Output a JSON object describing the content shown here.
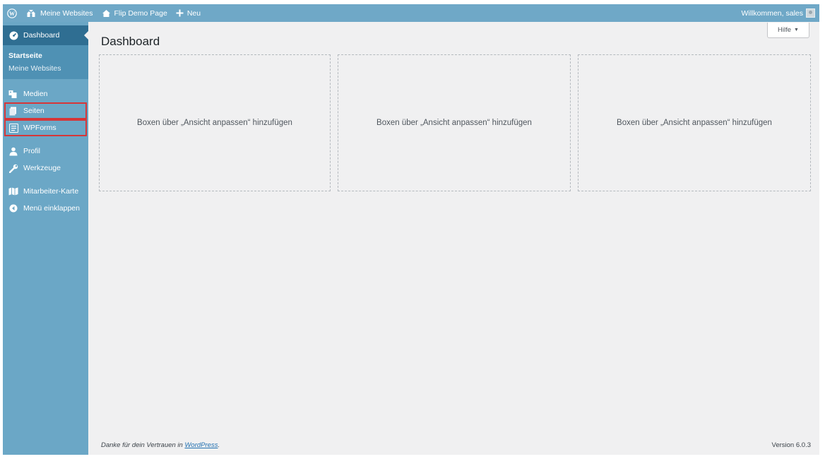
{
  "adminbar": {
    "wp_icon": "wordpress-logo-icon",
    "my_sites": "Meine Websites",
    "site_name": "Flip Demo Page",
    "new": "Neu",
    "welcome": "Willkommen, sales"
  },
  "sidebar": {
    "dashboard": "Dashboard",
    "submenu": [
      "Startseite",
      "Meine Websites"
    ],
    "items": [
      {
        "label": "Medien",
        "icon": "media-icon"
      },
      {
        "label": "Seiten",
        "icon": "pages-icon"
      },
      {
        "label": "WPForms",
        "icon": "wpforms-icon"
      },
      {
        "label": "Profil",
        "icon": "profile-icon"
      },
      {
        "label": "Werkzeuge",
        "icon": "tools-icon"
      },
      {
        "label": "Mitarbeiter-Karte",
        "icon": "map-icon"
      },
      {
        "label": "Menü einklappen",
        "icon": "collapse-icon"
      }
    ],
    "highlight_color": "#d63638"
  },
  "main": {
    "title": "Dashboard",
    "help": "Hilfe",
    "boxes": [
      "Boxen über „Ansicht anpassen“ hinzufügen",
      "Boxen über „Ansicht anpassen“ hinzufügen",
      "Boxen über „Ansicht anpassen“ hinzufügen"
    ]
  },
  "footer": {
    "thanks_prefix": "Danke für dein Vertrauen in ",
    "thanks_link": "WordPress",
    "thanks_suffix": ".",
    "version": "Version 6.0.3"
  }
}
